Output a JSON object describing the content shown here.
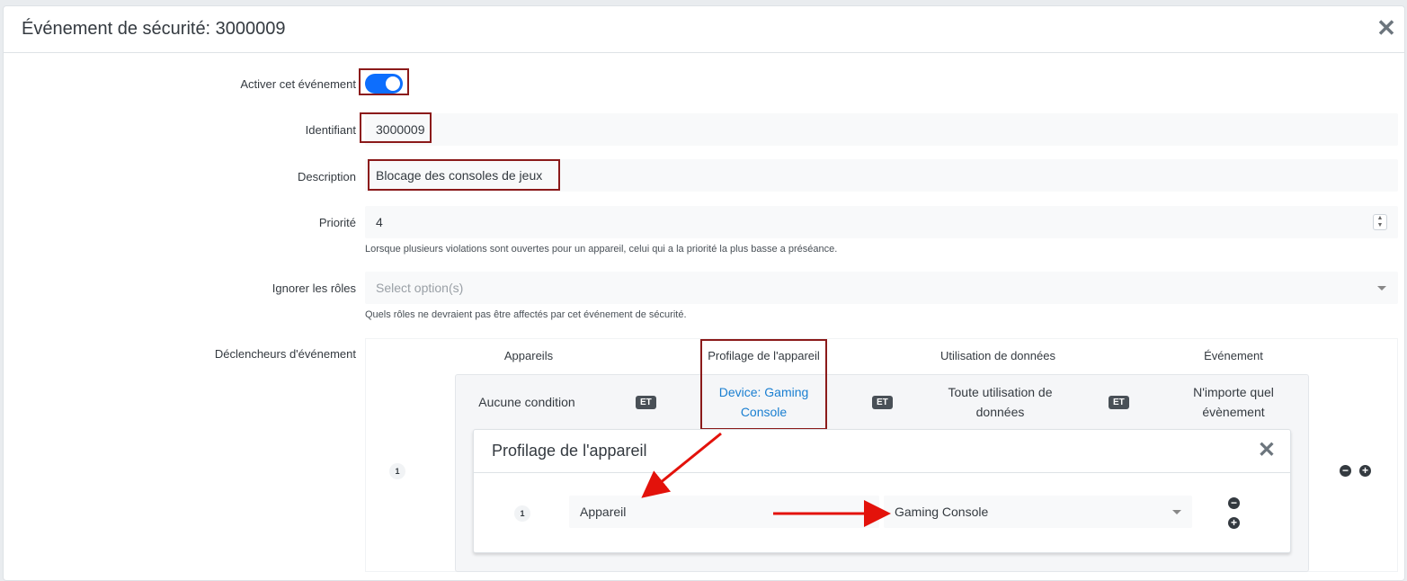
{
  "modal": {
    "title": "Événement de sécurité: 3000009",
    "close_label": "✕"
  },
  "form": {
    "enable": {
      "label": "Activer cet événement",
      "value": true
    },
    "identifier": {
      "label": "Identifiant",
      "value": "3000009"
    },
    "description": {
      "label": "Description",
      "value": "Blocage des consoles de jeux"
    },
    "priority": {
      "label": "Priorité",
      "value": "4",
      "help": "Lorsque plusieurs violations sont ouvertes pour un appareil, celui qui a la priorité la plus basse a préséance."
    },
    "ignore_roles": {
      "label": "Ignorer les rôles",
      "placeholder": "Select option(s)",
      "help": "Quels rôles ne devraient pas être affectés par cet événement de sécurité."
    },
    "triggers": {
      "label": "Déclencheurs d'événement"
    }
  },
  "trigger_table": {
    "headers": [
      "Appareils",
      "Profilage de l'appareil",
      "Utilisation de données",
      "Événement"
    ],
    "row_number": "1",
    "row": {
      "devices": "Aucune condition",
      "and1": "ET",
      "profiling_line1": "Device: Gaming",
      "profiling_line2": "Console",
      "and2": "ET",
      "data_line1": "Toute utilisation de",
      "data_line2": "données",
      "and3": "ET",
      "event_line1": "N'importe quel",
      "event_line2": "évènement"
    },
    "minus": "−",
    "plus": "+"
  },
  "profiling_panel": {
    "title": "Profilage de l'appareil",
    "close_label": "✕",
    "row_number": "1",
    "attribute": "Appareil",
    "value": "Gaming Console"
  },
  "colors": {
    "toggle": "#0d6efd",
    "highlight_border": "#8b1a1a",
    "arrow": "#e3120b",
    "link": "#1a7fd1"
  }
}
